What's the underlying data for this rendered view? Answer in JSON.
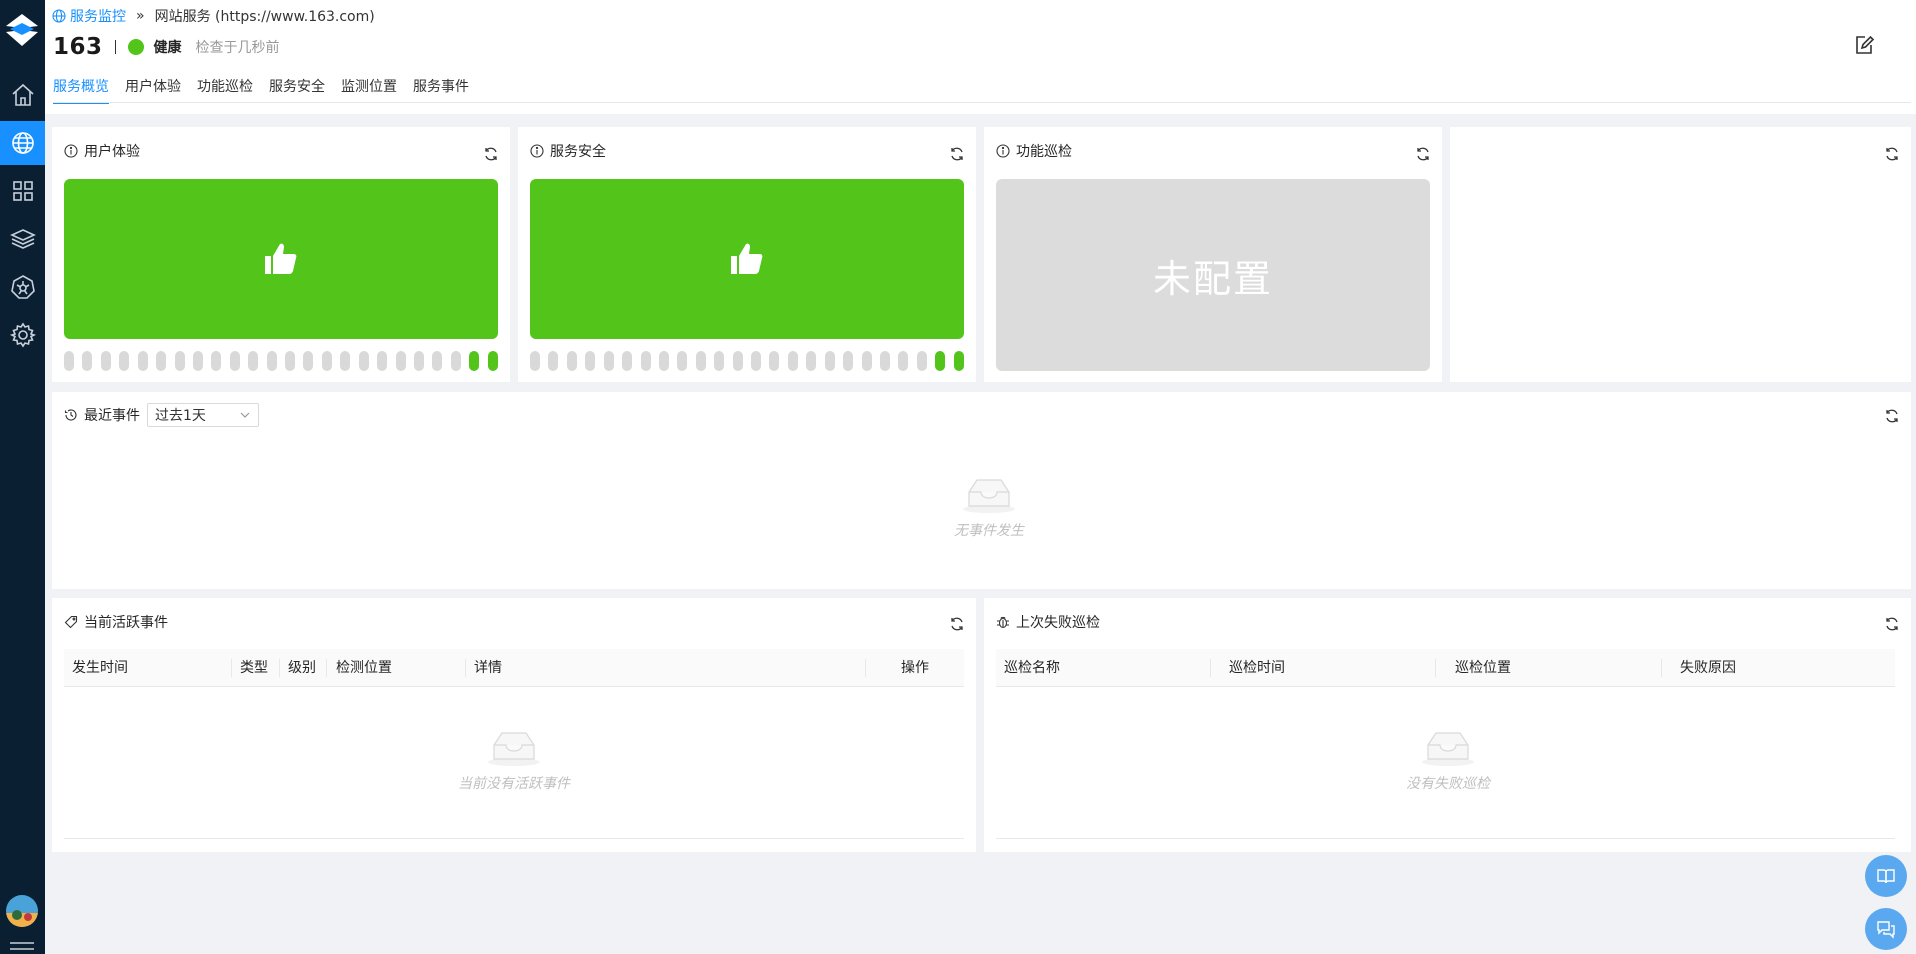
{
  "breadcrumb": {
    "parent": "服务监控",
    "separator": "»",
    "current": "网站服务 (https://www.163.com)"
  },
  "service": {
    "name": "163",
    "status": "健康",
    "checked": "检查于几秒前"
  },
  "tabs": [
    {
      "label": "服务概览",
      "active": true
    },
    {
      "label": "用户体验",
      "active": false
    },
    {
      "label": "功能巡检",
      "active": false
    },
    {
      "label": "服务安全",
      "active": false
    },
    {
      "label": "监测位置",
      "active": false
    },
    {
      "label": "服务事件",
      "active": false
    }
  ],
  "cards": {
    "user_experience": {
      "title": "用户体验",
      "history": [
        "none",
        "none",
        "none",
        "none",
        "none",
        "none",
        "none",
        "none",
        "none",
        "none",
        "none",
        "none",
        "none",
        "none",
        "none",
        "none",
        "none",
        "none",
        "none",
        "none",
        "none",
        "none",
        "ok",
        "ok"
      ]
    },
    "security": {
      "title": "服务安全",
      "history": [
        "none",
        "none",
        "none",
        "none",
        "none",
        "none",
        "none",
        "none",
        "none",
        "none",
        "none",
        "none",
        "none",
        "none",
        "none",
        "none",
        "none",
        "none",
        "none",
        "none",
        "none",
        "none",
        "ok",
        "ok"
      ]
    },
    "inspection": {
      "title": "功能巡检",
      "status_text": "未配置"
    }
  },
  "recent_events": {
    "title": "最近事件",
    "range_selected": "过去1天",
    "empty_text": "无事件发生"
  },
  "active_events": {
    "title": "当前活跃事件",
    "columns": [
      "发生时间",
      "类型",
      "级别",
      "检测位置",
      "详情",
      "操作"
    ],
    "empty_text": "当前没有活跃事件"
  },
  "failed_inspections": {
    "title": "上次失败巡检",
    "columns": [
      "巡检名称",
      "巡检时间",
      "巡检位置",
      "失败原因"
    ],
    "empty_text": "没有失败巡检"
  },
  "sidebar": {
    "items": [
      {
        "icon": "home-icon"
      },
      {
        "icon": "globe-icon",
        "active": true
      },
      {
        "icon": "apps-grid-icon"
      },
      {
        "icon": "layers-icon"
      },
      {
        "icon": "kubernetes-icon"
      },
      {
        "icon": "gear-icon"
      }
    ]
  },
  "colors": {
    "accent": "#1890ff",
    "healthy": "#52c41a",
    "sidebar": "#0b1f33",
    "unconfigured": "#dcdcdc"
  }
}
